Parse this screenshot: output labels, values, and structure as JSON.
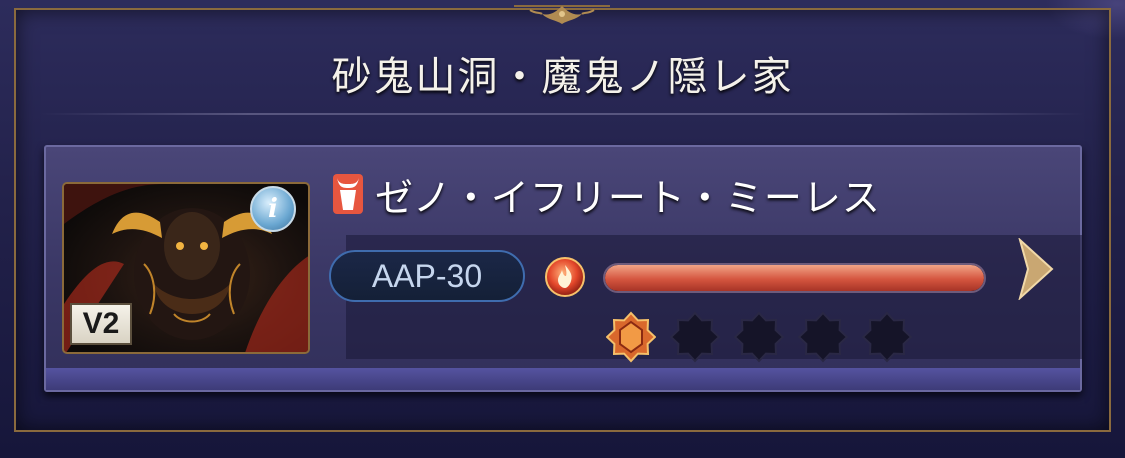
{
  "title": "砂鬼山洞・魔鬼ノ隠レ家",
  "enemy": {
    "name": "ゼノ・イフリート・ミーレス",
    "version_badge": "V2",
    "info_icon": "info-icon",
    "category_icon": "demon-horn-icon",
    "aap_label": "AAP-30",
    "element_icon": "fire-element-icon",
    "hp_fraction": 1.0
  },
  "break_slots": [
    {
      "state": "filled",
      "icon": "break-gem-icon"
    },
    {
      "state": "empty",
      "icon": "break-slot-empty-icon"
    },
    {
      "state": "empty",
      "icon": "break-slot-empty-icon"
    },
    {
      "state": "empty",
      "icon": "break-slot-empty-icon"
    },
    {
      "state": "empty",
      "icon": "break-slot-empty-icon"
    }
  ],
  "colors": {
    "gold": "#8a6a3e",
    "hp_fill": "#d4553f",
    "aap_border": "#3f6cae"
  }
}
